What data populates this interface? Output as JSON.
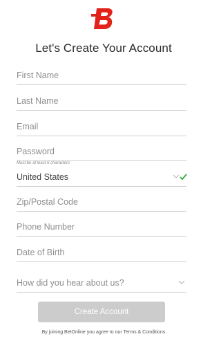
{
  "brand": {
    "accent": "#e2231a"
  },
  "header": {
    "title": "Let's Create Your Account"
  },
  "form": {
    "first_name": {
      "placeholder": "First Name"
    },
    "last_name": {
      "placeholder": "Last Name"
    },
    "email": {
      "placeholder": "Email"
    },
    "password": {
      "placeholder": "Password",
      "hint": "Must be at least 6 characters"
    },
    "country": {
      "value": "United States",
      "valid": true
    },
    "zip": {
      "placeholder": "Zip/Postal Code"
    },
    "phone": {
      "placeholder": "Phone Number"
    },
    "dob": {
      "placeholder": "Date of Birth"
    },
    "referral": {
      "placeholder": "How did you hear about us?"
    },
    "submit_label": "Create Account"
  },
  "footer": {
    "terms": "By joining BetOnline you agree to our Terms & Conditions"
  }
}
